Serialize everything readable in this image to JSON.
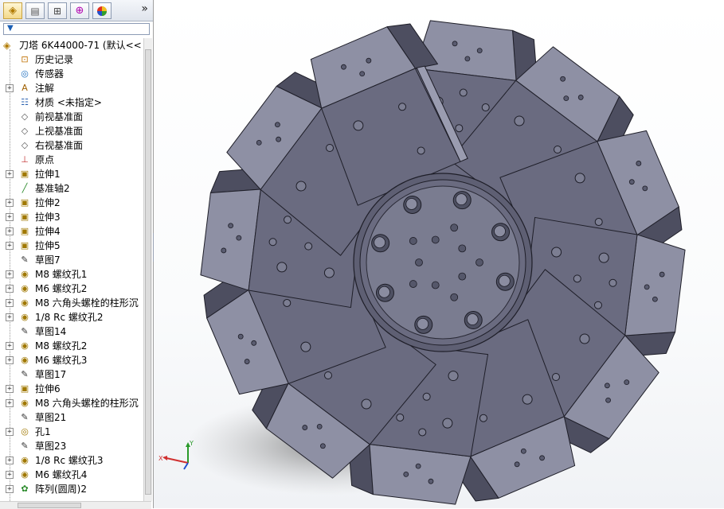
{
  "panel": {
    "tabs": [
      {
        "icon": "feature-manager-icon"
      },
      {
        "icon": "property-manager-icon"
      },
      {
        "icon": "configuration-manager-icon"
      },
      {
        "icon": "dimxpert-icon"
      },
      {
        "icon": "display-manager-icon"
      }
    ],
    "expand_glyph": "»",
    "filter_icon": "filter-icon"
  },
  "tree": {
    "root_label": "刀塔 6K44000-71  (默认<<",
    "items": [
      {
        "label": "历史记录",
        "icon": "history-icon",
        "expandable": false
      },
      {
        "label": "传感器",
        "icon": "sensor-icon",
        "expandable": false
      },
      {
        "label": "注解",
        "icon": "annotations-icon",
        "expandable": true
      },
      {
        "label": "材质 <未指定>",
        "icon": "material-icon",
        "expandable": false
      },
      {
        "label": "前视基准面",
        "icon": "plane-icon",
        "expandable": false
      },
      {
        "label": "上视基准面",
        "icon": "plane-icon",
        "expandable": false
      },
      {
        "label": "右视基准面",
        "icon": "plane-icon",
        "expandable": false
      },
      {
        "label": "原点",
        "icon": "origin-icon",
        "expandable": false
      },
      {
        "label": "拉伸1",
        "icon": "extrude-icon",
        "expandable": true
      },
      {
        "label": "基准轴2",
        "icon": "axis-icon",
        "expandable": false
      },
      {
        "label": "拉伸2",
        "icon": "extrude-icon",
        "expandable": true
      },
      {
        "label": "拉伸3",
        "icon": "extrude-icon",
        "expandable": true
      },
      {
        "label": "拉伸4",
        "icon": "extrude-icon",
        "expandable": true
      },
      {
        "label": "拉伸5",
        "icon": "extrude-icon",
        "expandable": true
      },
      {
        "label": "草图7",
        "icon": "sketch-icon",
        "expandable": false
      },
      {
        "label": "M8 螺纹孔1",
        "icon": "hole-wizard-icon",
        "expandable": true
      },
      {
        "label": "M6 螺纹孔2",
        "icon": "hole-wizard-icon",
        "expandable": true
      },
      {
        "label": "M8 六角头螺栓的柱形沉",
        "icon": "hole-wizard-icon",
        "expandable": true
      },
      {
        "label": "1/8 Rc 螺纹孔2",
        "icon": "hole-wizard-icon",
        "expandable": true
      },
      {
        "label": "草图14",
        "icon": "sketch-icon",
        "expandable": false
      },
      {
        "label": "M8 螺纹孔2",
        "icon": "hole-wizard-icon",
        "expandable": true
      },
      {
        "label": "M6 螺纹孔3",
        "icon": "hole-wizard-icon",
        "expandable": true
      },
      {
        "label": "草图17",
        "icon": "sketch-icon",
        "expandable": false
      },
      {
        "label": "拉伸6",
        "icon": "extrude-icon",
        "expandable": true
      },
      {
        "label": "M8 六角头螺栓的柱形沉",
        "icon": "hole-wizard-icon",
        "expandable": true
      },
      {
        "label": "草图21",
        "icon": "sketch-icon",
        "expandable": false
      },
      {
        "label": "孔1",
        "icon": "hole-icon",
        "expandable": true
      },
      {
        "label": "草图23",
        "icon": "sketch-icon",
        "expandable": false
      },
      {
        "label": "1/8 Rc 螺纹孔3",
        "icon": "hole-wizard-icon",
        "expandable": true
      },
      {
        "label": "M6 螺纹孔4",
        "icon": "hole-wizard-icon",
        "expandable": true
      },
      {
        "label": "阵列(圆周)2",
        "icon": "circular-pattern-icon",
        "expandable": true
      }
    ]
  },
  "triad": {
    "x_label": "X",
    "y_label": "Y",
    "z_label": "Z"
  },
  "colors": {
    "model_face": "#6a6b80",
    "model_light": "#8e90a4",
    "model_dark": "#4d4e60",
    "hole": "#7c7e92",
    "selection_accent": "#1b5fb5"
  }
}
